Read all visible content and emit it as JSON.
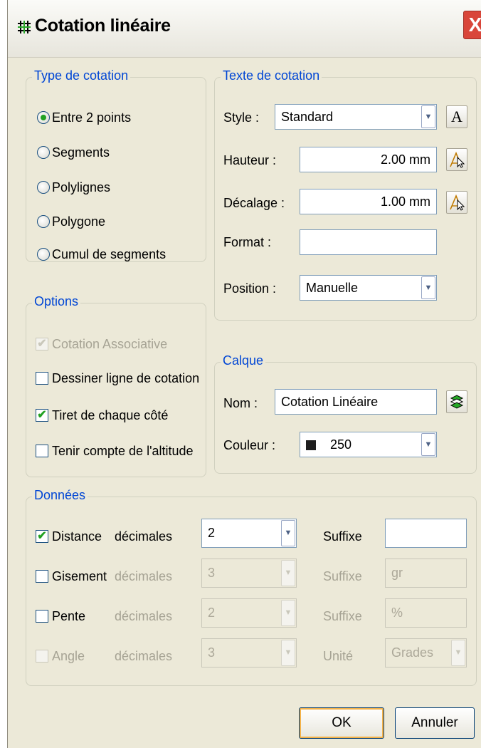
{
  "window": {
    "title": "Cotation linéaire",
    "icon": "grid-icon",
    "close_glyph": "X"
  },
  "type_cotation": {
    "legend": "Type de cotation",
    "options": [
      "Entre 2 points",
      "Segments",
      "Polylignes",
      "Polygone",
      "Cumul de segments"
    ],
    "selected": "Entre 2 points"
  },
  "options": {
    "legend": "Options",
    "associative": {
      "label": "Cotation Associative",
      "checked": true,
      "enabled": false
    },
    "dessiner": {
      "label": "Dessiner ligne de cotation",
      "checked": false
    },
    "tiret": {
      "label": "Tiret de chaque côté",
      "checked": true
    },
    "altitude": {
      "label": "Tenir compte de l'altitude",
      "checked": false
    }
  },
  "texte": {
    "legend": "Texte de cotation",
    "style_label": "Style :",
    "style_value": "Standard",
    "style_btn": "A",
    "hauteur_label": "Hauteur :",
    "hauteur_value": "2.00 mm",
    "decalage_label": "Décalage :",
    "decalage_value": "1.00 mm",
    "format_label": "Format :",
    "format_value": "",
    "position_label": "Position :",
    "position_value": "Manuelle"
  },
  "calque": {
    "legend": "Calque",
    "nom_label": "Nom :",
    "nom_value": "Cotation Linéaire",
    "couleur_label": "Couleur :",
    "couleur_value": "250",
    "couleur_swatch": "#1e1e1e"
  },
  "donnees": {
    "legend": "Données",
    "rows": [
      {
        "label": "Distance",
        "checked": true,
        "enabled": true,
        "dec_label": "décimales",
        "dec_value": "2",
        "suffix_label": "Suffixe",
        "suffix_value": ""
      },
      {
        "label": "Gisement",
        "checked": false,
        "enabled": true,
        "dec_label": "décimales",
        "dec_value": "3",
        "suffix_label": "Suffixe",
        "suffix_value": "gr"
      },
      {
        "label": "Pente",
        "checked": false,
        "enabled": true,
        "dec_label": "décimales",
        "dec_value": "2",
        "suffix_label": "Suffixe",
        "suffix_value": "%"
      },
      {
        "label": "Angle",
        "checked": false,
        "enabled": false,
        "dec_label": "décimales",
        "dec_value": "3",
        "suffix_label": "Unité",
        "suffix_value": "Grades"
      }
    ]
  },
  "buttons": {
    "ok": "OK",
    "cancel": "Annuler"
  }
}
